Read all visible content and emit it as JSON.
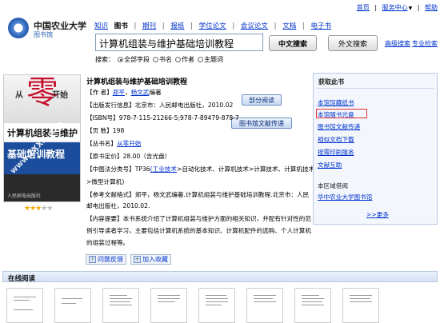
{
  "header": {
    "logo_title": "中国农业大学",
    "logo_sub": "图书馆",
    "toplinks": [
      "首页",
      "服务中心",
      "帮助"
    ],
    "toplink_sep": "|",
    "dropdown_arrow": "▼"
  },
  "tabs": [
    {
      "label": "知识",
      "active": false
    },
    {
      "label": "图书",
      "active": true
    },
    {
      "label": "期刊",
      "active": false
    },
    {
      "label": "报纸",
      "active": false
    },
    {
      "label": "学位论文",
      "active": false
    },
    {
      "label": "会议论文",
      "active": false
    },
    {
      "label": "文档",
      "active": false
    },
    {
      "label": "电子书",
      "active": false
    }
  ],
  "tab_separator": "|",
  "search": {
    "value": "计算机组装与维护基础培训教程",
    "btn_zh": "中文搜索",
    "btn_foreign": "外文搜索",
    "advanced": "高级搜索",
    "professional": "专业检索",
    "label": "搜索：",
    "options": [
      {
        "label": "全部字段",
        "checked": true
      },
      {
        "label": "书名",
        "checked": false
      },
      {
        "label": "作者",
        "checked": false
      },
      {
        "label": "主题词",
        "checked": false
      }
    ]
  },
  "cover": {
    "cong": "从",
    "zero": "零",
    "kaishi": "开始",
    "line1": "计算机组装与维护",
    "line2": "基础培训教程",
    "watermark": "www.ZXXK.com",
    "publisher": "人民邮电出版社"
  },
  "rating": {
    "stars": 3,
    "max": 5
  },
  "book": {
    "title": "计算机组装与维护基础培训教程",
    "read_btn": "部分阅读",
    "delivery_btn": "图书馆文献传递",
    "author_label": "【作 者】",
    "author_1": "郑平",
    "author_2": "杨文武",
    "author_suffix": "编著",
    "pub_label": "【出版发行信息】",
    "pub": "北京市：人民邮电出版社，2010.02",
    "isbn_label": "【ISBN号】",
    "isbn": "978-7-115-21266-5;978-7-89479-878-7",
    "pages_label": "【页 数】",
    "pages": "198",
    "series_label": "【丛书名】",
    "series": "从零开始",
    "price_label": "【原书定价】",
    "price": "28.00（含光盘）",
    "clc_label": "【中图法分类号】",
    "clc_code": "TP36",
    "clc_cat1": "(工业技术",
    "clc_rest": ">自动化技术、计算机技术>计算技术、计算机技术",
    "clc_cont": ">微型计算机)",
    "ref_label": "【参考文献格式】",
    "ref": "郑平，杨文武编著.计算机组装与维护基础培训教程.北京市：人民",
    "ref_cont": "邮电出版社，2010.02.",
    "abstract_label": "【内容提要】",
    "abstract_1": "本书系统介绍了计算机组装与维护方面的相关知识，并配有针对性的范",
    "abstract_2": "例引导读者学习，主要包括计算机系统的基本知识、计算机配件的选购、个人计算机",
    "abstract_3": "的组装过程等。",
    "feedback": "问题反馈",
    "collect": "加入收藏"
  },
  "sidebar": {
    "title": "获取此书",
    "links": [
      "本馆馆藏纸书",
      "本馆随书光盘",
      "图书馆文献传递",
      "相似文档下载",
      "按需印刷服务",
      "文献互助"
    ],
    "highlighted_index": 1,
    "other_title": "本区域借阅",
    "other_link": "华中农业大学图书馆",
    "more": ">>更多"
  },
  "online": {
    "title": "在线阅读"
  }
}
